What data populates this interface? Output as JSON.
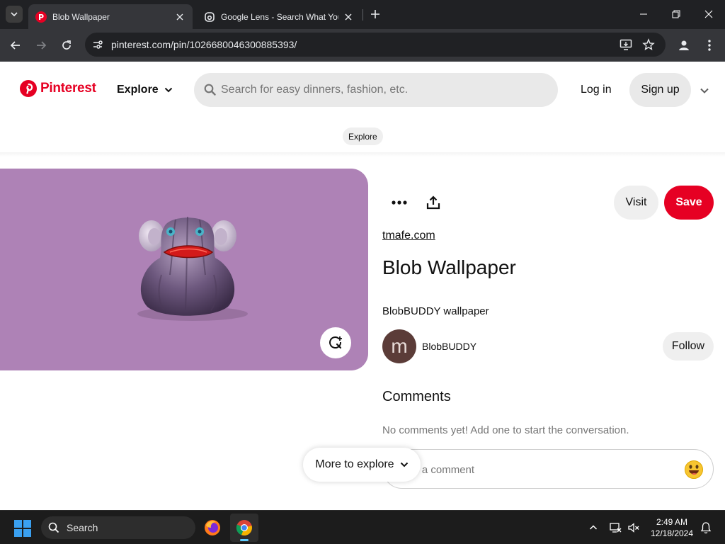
{
  "browser": {
    "tabs": [
      {
        "title": "Blob Wallpaper",
        "active": true,
        "favicon": "pinterest-icon"
      },
      {
        "title": "Google Lens - Search What You See",
        "active": false,
        "favicon": "google-lens-icon"
      }
    ],
    "url": "pinterest.com/pin/1026680046300885393/"
  },
  "header": {
    "brand": "Pinterest",
    "explore_label": "Explore",
    "search_placeholder": "Search for easy dinners, fashion, etc.",
    "login_label": "Log in",
    "signup_label": "Sign up"
  },
  "breadcrumb": "Explore",
  "pin": {
    "visit_label": "Visit",
    "save_label": "Save",
    "source": "tmafe.com",
    "title": "Blob Wallpaper",
    "description": "BlobBUDDY wallpaper",
    "creator": {
      "initial": "m",
      "name": "BlobBUDDY"
    },
    "follow_label": "Follow",
    "image_bg": "#ae82b6"
  },
  "comments": {
    "heading": "Comments",
    "empty_text": "No comments yet! Add one to start the conversation.",
    "placeholder": "Add a comment"
  },
  "more_to_explore": "More to explore",
  "taskbar": {
    "search_label": "Search",
    "time": "2:49 AM",
    "date": "12/18/2024"
  },
  "colors": {
    "brand_red": "#e60023",
    "tabstrip": "#202124",
    "toolbar": "#35363a",
    "taskbar": "#1c1c1c"
  }
}
